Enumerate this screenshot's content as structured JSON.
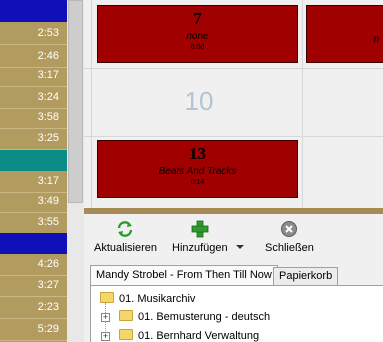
{
  "time_list": {
    "rows": [
      {
        "time": "",
        "color": "blue"
      },
      {
        "time": "2:53",
        "color": "gold"
      },
      {
        "time": "2:46",
        "color": "gold"
      },
      {
        "time": "3:17",
        "color": "gold"
      },
      {
        "time": "3:24",
        "color": "gold"
      },
      {
        "time": "3:58",
        "color": "gold"
      },
      {
        "time": "3:25",
        "color": "gold"
      },
      {
        "time": "",
        "color": "teal"
      },
      {
        "time": "3:17",
        "color": "gold"
      },
      {
        "time": "3:49",
        "color": "gold"
      },
      {
        "time": "3:55",
        "color": "gold"
      },
      {
        "time": "",
        "color": "blue"
      },
      {
        "time": "4:26",
        "color": "gold"
      },
      {
        "time": "3:27",
        "color": "gold"
      },
      {
        "time": "2:23",
        "color": "gold"
      },
      {
        "time": "5:29",
        "color": "gold"
      }
    ]
  },
  "grid": {
    "tile_a": {
      "number": "7",
      "title": "none",
      "duration": "0:00"
    },
    "tile_b": {
      "number": "13",
      "title": "Beats And Tracks",
      "duration": "0:14"
    },
    "empty_slot": "10",
    "edge_letter": "n"
  },
  "toolbar": {
    "refresh_label": "Aktualisieren",
    "add_label": "Hinzufügen",
    "close_label": "Schließen",
    "icons": {
      "refresh": "refresh-icon",
      "add": "plus-icon",
      "close": "close-icon",
      "dropdown": "chevron-down-icon"
    }
  },
  "tabs": [
    {
      "label": "Mandy Strobel - From Then Till Now",
      "active": true
    },
    {
      "label": "Papierkorb",
      "active": false
    }
  ],
  "tree": {
    "root": "01. Musikarchiv",
    "children": [
      "01. Bemusterung - deutsch",
      "01. Bernhard Verwaltung"
    ]
  },
  "colors": {
    "tile": "#a10000",
    "time_gold": "#b29b5e",
    "row_blue": "#1010b8",
    "row_teal": "#0c8c87"
  }
}
